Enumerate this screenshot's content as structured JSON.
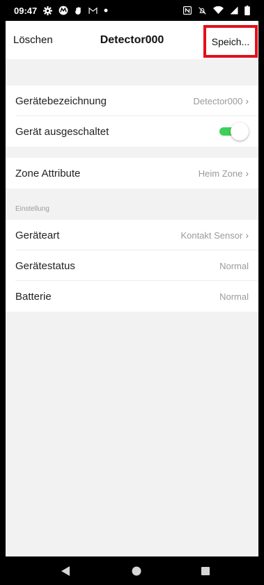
{
  "status_bar": {
    "time": "09:47",
    "left_icons": [
      "settings-icon",
      "motorola-icon",
      "hand-icon",
      "gmail-icon",
      "dot-icon"
    ],
    "right_icons": [
      "nfc-icon",
      "mute-icon",
      "wifi-icon",
      "signal-icon",
      "battery-icon"
    ]
  },
  "header": {
    "left_action": "Löschen",
    "title": "Detector000",
    "right_action": "Speich..."
  },
  "group1": {
    "device_name_label": "Gerätebezeichnung",
    "device_name_value": "Detector000",
    "device_off_label": "Gerät ausgeschaltet",
    "device_off_state": true
  },
  "group2": {
    "zone_label": "Zone Attribute",
    "zone_value": "Heim Zone"
  },
  "settings": {
    "caption": "Einstellung",
    "type_label": "Geräteart",
    "type_value": "Kontakt Sensor",
    "status_label": "Gerätestatus",
    "status_value": "Normal",
    "battery_label": "Batterie",
    "battery_value": "Normal"
  },
  "colors": {
    "accent_green": "#3ed05a",
    "highlight_red": "#e1101a"
  }
}
